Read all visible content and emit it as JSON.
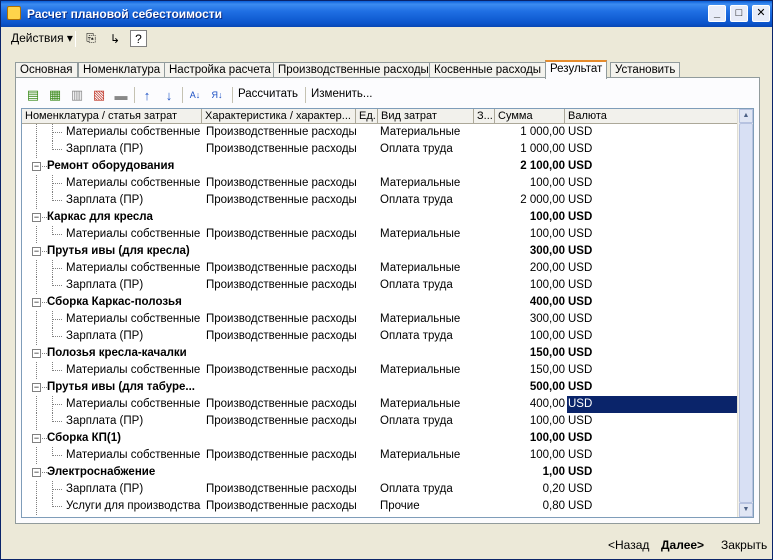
{
  "window": {
    "title": "Расчет плановой себестоимости"
  },
  "menubar": {
    "actions_label": "Действия"
  },
  "tabs": [
    {
      "label": "Основная"
    },
    {
      "label": "Номенклатура"
    },
    {
      "label": "Настройка расчета"
    },
    {
      "label": "Производственные расходы"
    },
    {
      "label": "Косвенные расходы"
    },
    {
      "label": "Результат",
      "active": true
    },
    {
      "label": "Установить"
    }
  ],
  "toolbar": {
    "calculate_label": "Рассчитать",
    "edit_label": "Изменить..."
  },
  "columns": {
    "nomenclature": "Номенклатура / статья затрат",
    "characteristic": "Характеристика / характер...",
    "unit": "Ед.",
    "cost_type": "Вид затрат",
    "qty": "З...",
    "sum": "Сумма",
    "currency": "Валюта"
  },
  "rows": [
    {
      "name": "Материалы собственные",
      "char": "Производственные расходы",
      "type": "Материальные",
      "sum": "1 000,00",
      "cur": "USD",
      "group": false
    },
    {
      "name": "Зарплата (ПР)",
      "char": "Производственные расходы",
      "type": "Оплата труда",
      "sum": "1 000,00",
      "cur": "USD",
      "group": false
    },
    {
      "name": "Ремонт оборудования",
      "char": "",
      "type": "",
      "sum": "2 100,00",
      "cur": "USD",
      "group": true
    },
    {
      "name": "Материалы собственные",
      "char": "Производственные расходы",
      "type": "Материальные",
      "sum": "100,00",
      "cur": "USD",
      "group": false
    },
    {
      "name": "Зарплата (ПР)",
      "char": "Производственные расходы",
      "type": "Оплата труда",
      "sum": "2 000,00",
      "cur": "USD",
      "group": false
    },
    {
      "name": "Каркас для кресла",
      "char": "",
      "type": "",
      "sum": "100,00",
      "cur": "USD",
      "group": true
    },
    {
      "name": "Материалы собственные",
      "char": "Производственные расходы",
      "type": "Материальные",
      "sum": "100,00",
      "cur": "USD",
      "group": false
    },
    {
      "name": "Прутья ивы (для кресла)",
      "char": "",
      "type": "",
      "sum": "300,00",
      "cur": "USD",
      "group": true
    },
    {
      "name": "Материалы собственные",
      "char": "Производственные расходы",
      "type": "Материальные",
      "sum": "200,00",
      "cur": "USD",
      "group": false
    },
    {
      "name": "Зарплата (ПР)",
      "char": "Производственные расходы",
      "type": "Оплата труда",
      "sum": "100,00",
      "cur": "USD",
      "group": false
    },
    {
      "name": "Сборка Каркас-полозья",
      "char": "",
      "type": "",
      "sum": "400,00",
      "cur": "USD",
      "group": true
    },
    {
      "name": "Материалы собственные",
      "char": "Производственные расходы",
      "type": "Материальные",
      "sum": "300,00",
      "cur": "USD",
      "group": false
    },
    {
      "name": "Зарплата (ПР)",
      "char": "Производственные расходы",
      "type": "Оплата труда",
      "sum": "100,00",
      "cur": "USD",
      "group": false
    },
    {
      "name": "Полозья кресла-качалки",
      "char": "",
      "type": "",
      "sum": "150,00",
      "cur": "USD",
      "group": true
    },
    {
      "name": "Материалы собственные",
      "char": "Производственные расходы",
      "type": "Материальные",
      "sum": "150,00",
      "cur": "USD",
      "group": false
    },
    {
      "name": "Прутья ивы (для табуре...",
      "char": "",
      "type": "",
      "sum": "500,00",
      "cur": "USD",
      "group": true
    },
    {
      "name": "Материалы собственные",
      "char": "Производственные расходы",
      "type": "Материальные",
      "sum": "400,00",
      "cur": "USD",
      "group": false,
      "selected": true
    },
    {
      "name": "Зарплата (ПР)",
      "char": "Производственные расходы",
      "type": "Оплата труда",
      "sum": "100,00",
      "cur": "USD",
      "group": false
    },
    {
      "name": "Сборка КП(1)",
      "char": "",
      "type": "",
      "sum": "100,00",
      "cur": "USD",
      "group": true
    },
    {
      "name": "Материалы собственные",
      "char": "Производственные расходы",
      "type": "Материальные",
      "sum": "100,00",
      "cur": "USD",
      "group": false
    },
    {
      "name": "Электроснабжение",
      "char": "",
      "type": "",
      "sum": "1,00",
      "cur": "USD",
      "group": true
    },
    {
      "name": "Зарплата (ПР)",
      "char": "Производственные расходы",
      "type": "Оплата труда",
      "sum": "0,20",
      "cur": "USD",
      "group": false
    },
    {
      "name": "Услуги для производства",
      "char": "Производственные расходы",
      "type": "Прочие",
      "sum": "0,80",
      "cur": "USD",
      "group": false,
      "last": true
    }
  ],
  "footer": {
    "back_label": "<Назад",
    "next_label": "Далее>",
    "close_label": "Закрыть"
  },
  "colors": {
    "selection": "#0a246a",
    "active_tab_accent": "#e68b2c",
    "titlebar": "#0b55cc"
  }
}
